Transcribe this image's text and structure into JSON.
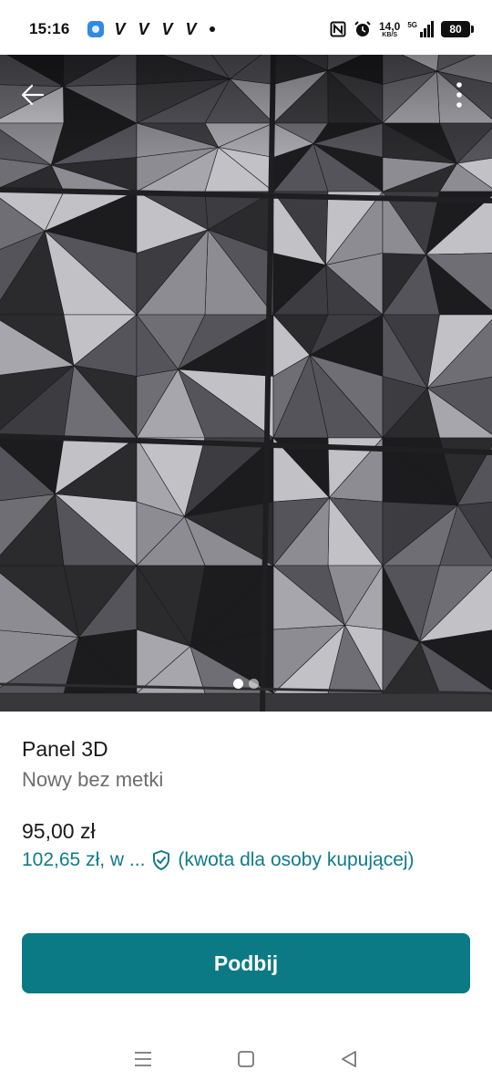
{
  "status_bar": {
    "time": "15:16",
    "notification_glyphs": [
      "V",
      "V",
      "V",
      "V"
    ],
    "net_speed_value": "14,0",
    "net_speed_unit": "KB/S",
    "network": "5G",
    "battery": "80"
  },
  "photo": {
    "page_count": 2,
    "active_page": 1,
    "icons": {
      "back": "arrow-left-icon",
      "more": "more-vertical-icon"
    }
  },
  "listing": {
    "title": "Panel 3D",
    "condition": "Nowy bez metki",
    "price": "95,00 zł",
    "buyer_price": "102,65 zł, w ...",
    "buyer_note": "(kwota dla osoby kupującej)"
  },
  "actions": {
    "bump_label": "Podbij"
  },
  "colors": {
    "accent": "#0b7a85",
    "buyer_text": "#0f7b8a"
  }
}
